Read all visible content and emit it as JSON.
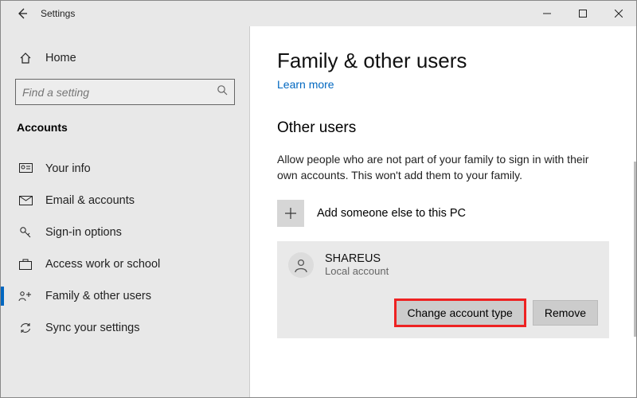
{
  "window": {
    "title": "Settings"
  },
  "sidebar": {
    "home_label": "Home",
    "search_placeholder": "Find a setting",
    "section": "Accounts",
    "items": [
      {
        "label": "Your info"
      },
      {
        "label": "Email & accounts"
      },
      {
        "label": "Sign-in options"
      },
      {
        "label": "Access work or school"
      },
      {
        "label": "Family & other users"
      },
      {
        "label": "Sync your settings"
      }
    ]
  },
  "main": {
    "title": "Family & other users",
    "learn_more": "Learn more",
    "other_users_heading": "Other users",
    "other_users_desc": "Allow people who are not part of your family to sign in with their own accounts. This won't add them to your family.",
    "add_label": "Add someone else to this PC",
    "user": {
      "name": "SHAREUS",
      "type": "Local account"
    },
    "change_btn": "Change account type",
    "remove_btn": "Remove"
  }
}
